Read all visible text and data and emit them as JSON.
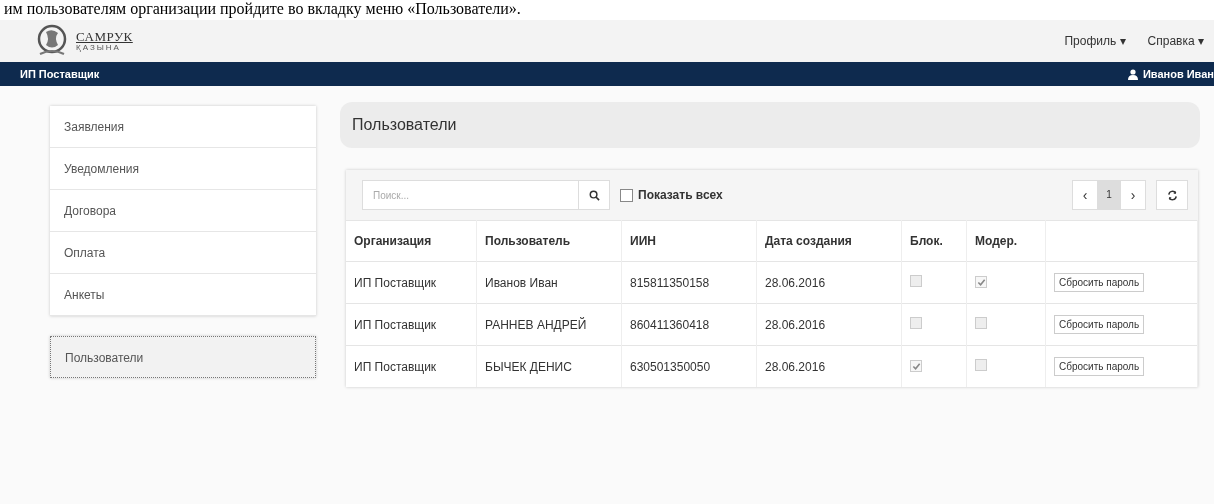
{
  "document_text": "им пользователям организации пройдите во вкладку меню «Пользователи».",
  "header": {
    "logo": {
      "name": "САМРУК",
      "subtitle": "ҚАЗЫНА"
    },
    "menus": [
      {
        "label": "Профиль",
        "caret": "▾"
      },
      {
        "label": "Справка",
        "caret": "▾"
      }
    ]
  },
  "navbar": {
    "organization": "ИП Поставщик",
    "user": "Иванов Иван"
  },
  "sidebar": {
    "groups": [
      {
        "items": [
          {
            "label": "Заявления",
            "selected": false
          },
          {
            "label": "Уведомления",
            "selected": false
          },
          {
            "label": "Договора",
            "selected": false
          },
          {
            "label": "Оплата",
            "selected": false
          },
          {
            "label": "Анкеты",
            "selected": false
          }
        ]
      },
      {
        "items": [
          {
            "label": "Пользователи",
            "selected": true
          }
        ]
      }
    ]
  },
  "page_title": "Пользователи",
  "toolbar": {
    "search": {
      "placeholder": "Поиск..."
    },
    "show_all": {
      "label": "Показать всех",
      "checked": false
    },
    "pagination": {
      "prev": "‹",
      "pages": [
        {
          "label": "1",
          "selected": true
        }
      ],
      "next": "›"
    }
  },
  "table": {
    "columns": [
      "Организация",
      "Пользователь",
      "ИИН",
      "Дата создания",
      "Блок.",
      "Модер."
    ],
    "rows": [
      {
        "organization": "ИП Поставщик",
        "user": "Иванов Иван",
        "iin": "815811350158",
        "created": "28.06.2016",
        "blocked": false,
        "moderator": true,
        "action": "Сбросить пароль"
      },
      {
        "organization": "ИП Поставщик",
        "user": "РАННЕВ АНДРЕЙ",
        "iin": "860411360418",
        "created": "28.06.2016",
        "blocked": false,
        "moderator": false,
        "action": "Сбросить пароль"
      },
      {
        "organization": "ИП Поставщик",
        "user": "БЫЧЕК ДЕНИС",
        "iin": "630501350050",
        "created": "28.06.2016",
        "blocked": true,
        "moderator": false,
        "action": "Сбросить пароль"
      }
    ]
  }
}
